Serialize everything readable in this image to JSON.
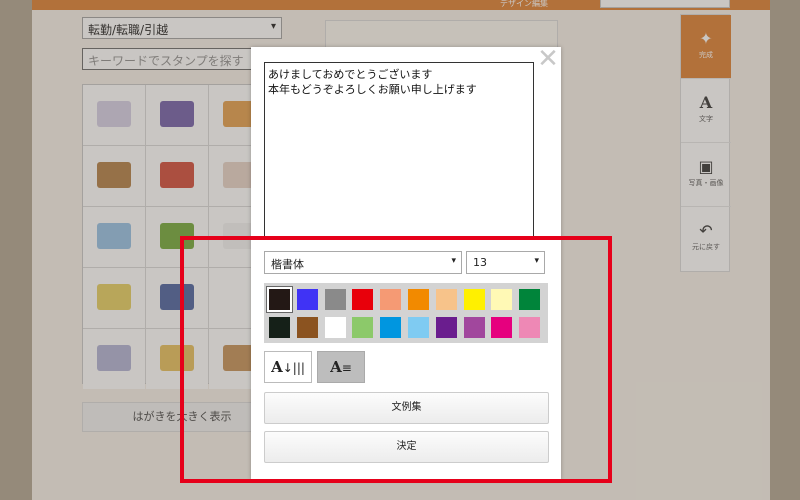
{
  "app": {
    "header_title": "デザイン編集"
  },
  "stamp_panel": {
    "category_select": "転勤/転職/引越",
    "search_placeholder": "キーワードでスタンプを探す",
    "big_view_button": "はがきを大きく表示",
    "stamps": [
      {
        "color": "#d8d3e8"
      },
      {
        "color": "#7e6db0"
      },
      {
        "color": "#e6a75a"
      },
      {
        "color": "#b98a55"
      },
      {
        "color": "#d65a4a"
      },
      {
        "color": "#e9d7cc"
      },
      {
        "color": "#9fc7e8"
      },
      {
        "color": "#7fb14a"
      },
      {
        "color": "#f4f4f4"
      },
      {
        "color": "#e8d36e"
      },
      {
        "color": "#5a6fa8"
      },
      {
        "color": "#ffffff"
      },
      {
        "color": "#b7b9d8"
      },
      {
        "color": "#e9c56a"
      },
      {
        "color": "#c99a66"
      }
    ]
  },
  "toolbar": {
    "done": {
      "label": "完成",
      "icon": "sparkle-doc-icon"
    },
    "text": {
      "label": "文字",
      "icon": "letter-a-icon"
    },
    "photo": {
      "label": "写真・画像",
      "icon": "image-icon"
    },
    "undo": {
      "label": "元に戻す",
      "icon": "undo-icon"
    }
  },
  "modal": {
    "close_label": "✕",
    "message_text": "あけましておめでとうございます\n本年もどうぞよろしくお願い申し上げます",
    "font_select": "楷書体",
    "size_select": "13",
    "palette": [
      "#231815",
      "#4033f5",
      "#8a8a8a",
      "#e8000b",
      "#f59a74",
      "#f28a00",
      "#f7c38a",
      "#fff000",
      "#fff9b5",
      "#00843a",
      "#152018",
      "#8b5320",
      "#ffffff",
      "#8cc96a",
      "#0096e0",
      "#7fcbf2",
      "#6a1d8e",
      "#a1479d",
      "#e6007e",
      "#ee88b5"
    ],
    "selected_color_index": 0,
    "vertical_button": {
      "letter": "A",
      "glyph": "↓|||"
    },
    "horizontal_button": {
      "letter": "A",
      "glyph": "≡"
    },
    "examples_button": "文例集",
    "confirm_button": "決定"
  }
}
